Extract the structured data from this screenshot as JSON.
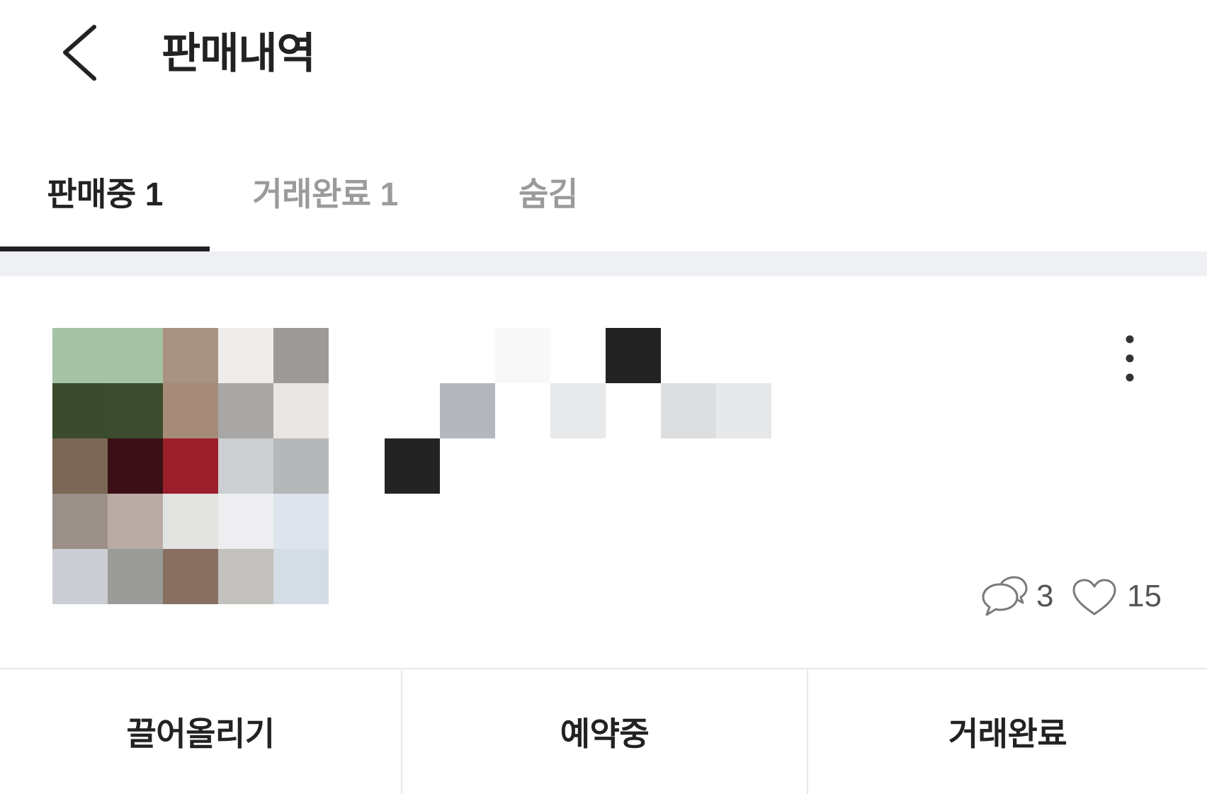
{
  "header": {
    "title": "판매내역",
    "back_icon": "chevron-left-icon"
  },
  "tabs": [
    {
      "label": "판매중",
      "count": "1",
      "active": true
    },
    {
      "label": "거래완료",
      "count": "1",
      "active": false
    },
    {
      "label": "숨김",
      "active": false
    }
  ],
  "listing": {
    "thumbnail_pixels": [
      [
        "#a6c3a6",
        "#a6c2a4",
        "#a89282",
        "#efece9",
        "#9c9b99"
      ],
      [
        "#3b4b2d",
        "#3d4c2e",
        "#a58b78",
        "#a8a7a5",
        "#e9e6e3"
      ],
      [
        "#7b6755",
        "#3a0f15",
        "#9b1f2b",
        "#cccfd2",
        "#b6b7b9"
      ],
      [
        "#9b9087",
        "#b9aba3",
        "#e3e3e2",
        "#eeeef0",
        "#dee4eb"
      ],
      [
        "#cacdd1",
        "#9b9b99",
        "#876f62",
        "#c3c1bd",
        "#d4dde6"
      ]
    ],
    "title_mosaic": [
      [
        null,
        null,
        "#f8f8f8",
        null,
        "#232323",
        null,
        null
      ],
      [
        null,
        "#b4b7be",
        null,
        "#e8e9ea",
        null,
        "#dddee0",
        "#e7e8e9"
      ],
      [
        "#232323",
        null,
        null,
        null,
        null,
        null,
        null
      ]
    ],
    "menu_icon": "more-vertical-icon",
    "chat_icon": "chat-bubbles-icon",
    "chat_count": "3",
    "like_icon": "heart-icon",
    "like_count": "15"
  },
  "actions": [
    {
      "label": "끌어올리기"
    },
    {
      "label": "예약중"
    },
    {
      "label": "거래완료"
    }
  ],
  "colors": {
    "text_primary": "#222222",
    "text_inactive": "#9b9b9b",
    "stat_text": "#555555",
    "divider": "#e7e8eb",
    "band": "#eff0f3"
  }
}
